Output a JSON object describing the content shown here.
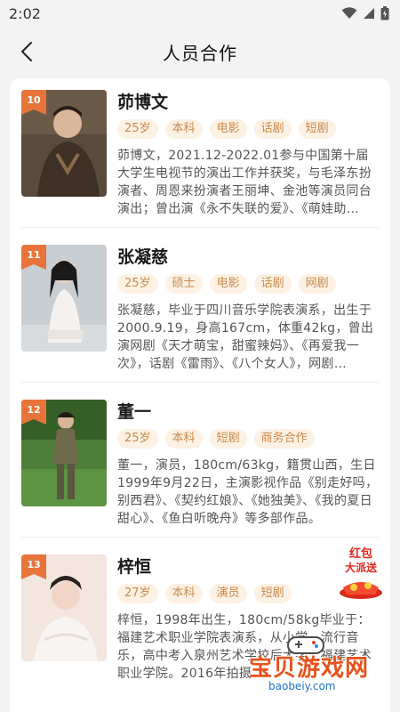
{
  "status": {
    "time": "2:02"
  },
  "header": {
    "title": "人员合作"
  },
  "people": [
    {
      "rank": "10",
      "name": "茆博文",
      "tags": [
        "25岁",
        "本科",
        "电影",
        "话剧",
        "短剧"
      ],
      "desc": "茆博文，2021.12-2022.01参与中国第十届大学生电视节的演出工作并获奖，与毛泽东扮演者、周恩来扮演者王丽坤、金池等演员同台演出；曾出演《永不失联的爱》、《萌娃助…"
    },
    {
      "rank": "11",
      "name": "张凝慈",
      "tags": [
        "25岁",
        "硕士",
        "电影",
        "话剧",
        "网剧"
      ],
      "desc": "张凝慈，毕业于四川音乐学院表演系，出生于2000.9.19，身高167cm，体重42kg，曾出演网剧《天才萌宝，甜蜜辣妈》、《再爱我一次》，话剧《雷雨》、《八个女人》，网剧…"
    },
    {
      "rank": "12",
      "name": "董一",
      "tags": [
        "25岁",
        "本科",
        "短剧",
        "商务合作"
      ],
      "desc": "董一，演员，180cm/63kg，籍贯山西，生日1999年9月22日，主演影视作品《别走好吗，别西君》、《契约红娘》、《她独美》、《我的夏日甜心》、《鱼白听晚舟》等多部作品。"
    },
    {
      "rank": "13",
      "name": "梓恒",
      "tags": [
        "27岁",
        "本科",
        "演员",
        "短剧"
      ],
      "desc": "梓恒，1998年出生，180cm/58kg毕业于：福建艺术职业学院表演系，从小学…流行音乐，高中考入泉州艺术学校后大学…福建艺术职业学院。2016年拍摄…"
    }
  ],
  "red_packet": {
    "line1": "红包",
    "line2": "大派送"
  },
  "watermark": {
    "text": "宝贝游戏网",
    "url": "baobeiy.com"
  },
  "colors": {
    "accent": "#e8743b",
    "tag_bg": "#fdf1e4",
    "tag_text": "#c98a4a"
  }
}
